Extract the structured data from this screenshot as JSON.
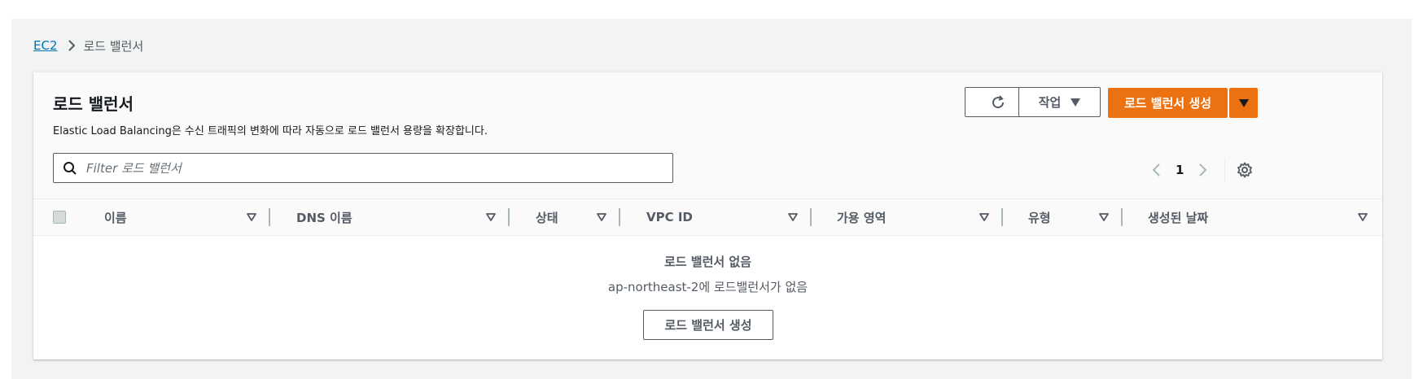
{
  "breadcrumb": {
    "root": "EC2",
    "current": "로드 밸런서"
  },
  "panel": {
    "title": "로드 밸런서",
    "description": "Elastic Load Balancing은 수신 트래픽의 변화에 따라 자동으로 로드 밸런서 용량을 확장합니다.",
    "actions_label": "작업",
    "create_label": "로드 밸런서 생성"
  },
  "search": {
    "placeholder": "Filter 로드 밸런서"
  },
  "pagination": {
    "current_page": "1"
  },
  "table": {
    "columns": [
      "이름",
      "DNS 이름",
      "상태",
      "VPC ID",
      "가용 영역",
      "유형",
      "생성된 날짜"
    ]
  },
  "empty": {
    "title": "로드 밸런서 없음",
    "message": "ap-northeast-2에 로드밸런서가 없음",
    "create_label": "로드 밸런서 생성"
  },
  "colors": {
    "primary": "#ec7211",
    "link": "#0073bb",
    "text": "#16191f",
    "muted": "#545b64"
  },
  "icons": {
    "breadcrumb_separator": "chevron-right-icon",
    "refresh": "refresh-icon",
    "actions_caret": "caret-down-icon",
    "search": "search-icon",
    "prev": "chevron-left-icon",
    "next": "chevron-right-icon",
    "settings": "gear-icon",
    "sort": "sort-caret-icon"
  }
}
